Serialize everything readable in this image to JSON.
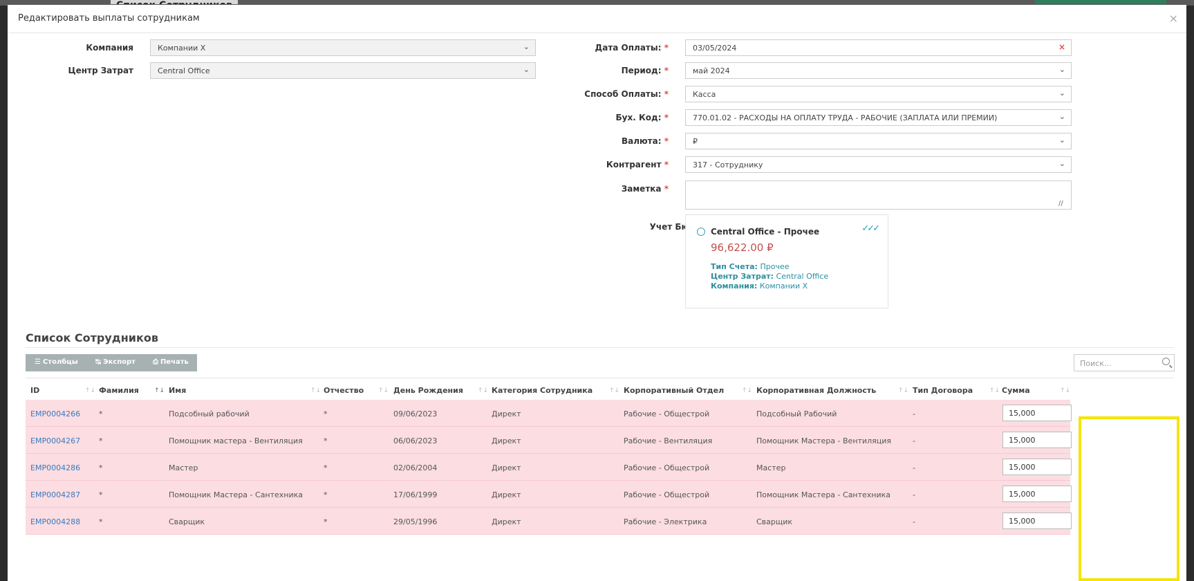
{
  "background": {
    "tab_label": "Список Сотрудников"
  },
  "modal": {
    "title": "Редактировать выплаты сотрудникам",
    "close": "×"
  },
  "form_left": [
    {
      "label": "Компания",
      "value": "Компании X"
    },
    {
      "label": "Центр Затрат",
      "value": "Central Office"
    }
  ],
  "form_right": [
    {
      "label": "Дата Оплаты:",
      "value": "03/05/2024"
    },
    {
      "label": "Период:",
      "value": "май 2024"
    },
    {
      "label": "Способ Оплаты:",
      "value": "Касса"
    },
    {
      "label": "Бух. Код:",
      "value": "770.01.02 - РАСХОДЫ НА ОПЛАТУ ТРУДА - РАБОЧИЕ (ЗАПЛАТА ИЛИ ПРЕМИИ)"
    },
    {
      "label": "Валюта:",
      "value": "₽"
    },
    {
      "label": "Контрагент",
      "value": "317 - Сотруднику"
    },
    {
      "label": "Заметка",
      "value": ""
    }
  ],
  "budget": {
    "label": "Учет Бюджета",
    "name": "Central Office - Прочее",
    "amount": "96,622.00 ₽",
    "lines": [
      {
        "key": "Тип Счета:",
        "value": "Прочее"
      },
      {
        "key": "Центр Затрат:",
        "value": "Central Office"
      },
      {
        "key": "Компания:",
        "value": "Компании X"
      }
    ]
  },
  "employees": {
    "title": "Список Сотрудников",
    "buttons": {
      "columns": "Столбцы",
      "export": "Экспорт",
      "print": "Печать"
    },
    "search_placeholder": "Поиск...",
    "columns": [
      "ID",
      "Фамилия",
      "Имя",
      "Отчество",
      "День Рождения",
      "Категория Сотрудника",
      "Корпоративный Отдел",
      "Корпоративная Должность",
      "Тип Договора",
      "Сумма"
    ],
    "rows": [
      {
        "id": "EMP0004266",
        "last": "*",
        "first": "Подсобный рабочий",
        "middle": "*",
        "birth": "09/06/2023",
        "category": "Директ",
        "dept": "Рабочие - Общестрой",
        "position": "Подсобный Рабочий",
        "contract": "-",
        "amount": "15,000"
      },
      {
        "id": "EMP0004267",
        "last": "*",
        "first": "Помощник мастера - Вентиляция",
        "middle": "*",
        "birth": "06/06/2023",
        "category": "Директ",
        "dept": "Рабочие - Вентиляция",
        "position": "Помощник Мастера - Вентиляция",
        "contract": "-",
        "amount": "15,000"
      },
      {
        "id": "EMP0004286",
        "last": "*",
        "first": "Мастер",
        "middle": "*",
        "birth": "02/06/2004",
        "category": "Директ",
        "dept": "Рабочие - Общестрой",
        "position": "Мастер",
        "contract": "-",
        "amount": "15,000"
      },
      {
        "id": "EMP0004287",
        "last": "*",
        "first": "Помощник Мастера - Сантехника",
        "middle": "*",
        "birth": "17/06/1999",
        "category": "Директ",
        "dept": "Рабочие - Общестрой",
        "position": "Помощник Мастера - Сантехника",
        "contract": "-",
        "amount": "15,000"
      },
      {
        "id": "EMP0004288",
        "last": "*",
        "first": "Сварщик",
        "middle": "*",
        "birth": "29/05/1996",
        "category": "Директ",
        "dept": "Рабочие - Электрика",
        "position": "Сварщик",
        "contract": "-",
        "amount": "15,000"
      }
    ]
  },
  "colors": {
    "row_bg": "#fbdde2",
    "highlight": "#f5e400",
    "link": "#3a7abf",
    "required": "#d9534f",
    "accent": "#2a9fb3"
  },
  "icons": [
    "close-icon",
    "chevron-down-icon",
    "clear-icon",
    "columns-icon",
    "export-icon",
    "print-icon",
    "search-icon",
    "sort-icon",
    "resize-icon",
    "check-icon"
  ]
}
